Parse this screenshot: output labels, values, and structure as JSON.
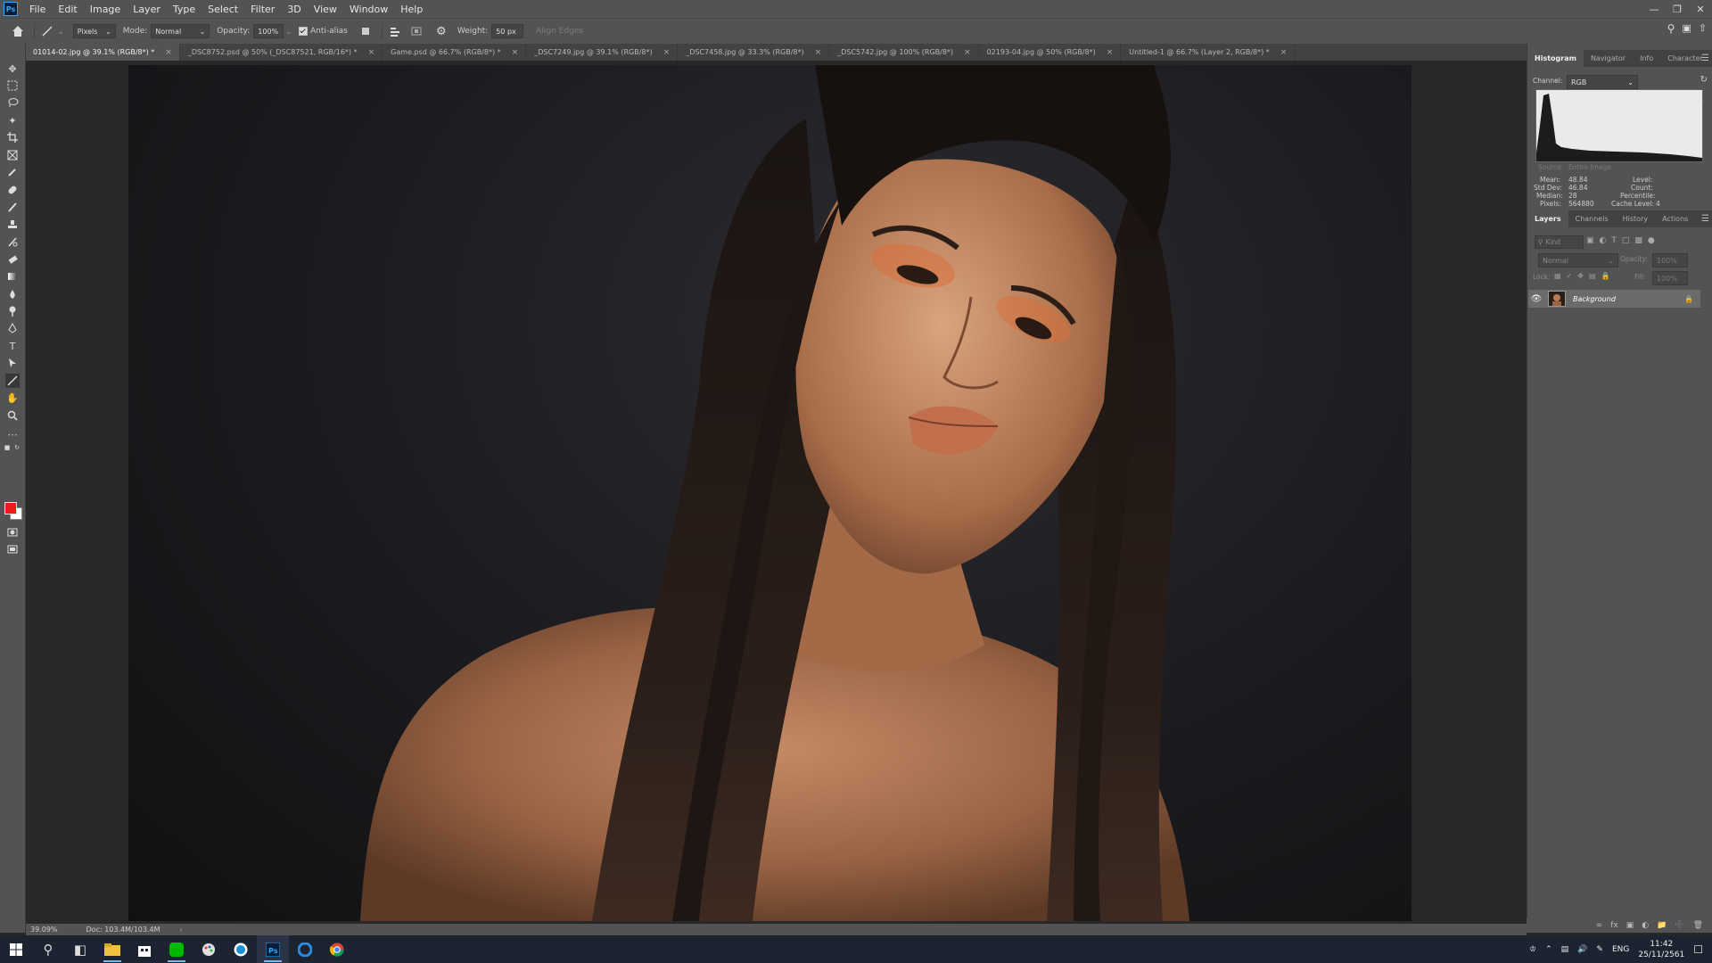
{
  "menu": {
    "logo": "Ps",
    "items": [
      "File",
      "Edit",
      "Image",
      "Layer",
      "Type",
      "Select",
      "Filter",
      "3D",
      "View",
      "Window",
      "Help"
    ]
  },
  "options": {
    "tool_mode_value": "Pixels",
    "mode_label": "Mode:",
    "mode_value": "Normal",
    "opacity_label": "Opacity:",
    "opacity_value": "100%",
    "antialias_label": "Anti-alias",
    "weight_label": "Weight:",
    "weight_value": "50 px",
    "align_edges_label": "Align Edges"
  },
  "tabs": [
    {
      "label": "01014-02.jpg @ 39.1% (RGB/8*) *",
      "active": true
    },
    {
      "label": "_DSC8752.psd @ 50% (_DSC87521, RGB/16*) *",
      "active": false
    },
    {
      "label": "Game.psd @ 66.7% (RGB/8*) *",
      "active": false
    },
    {
      "label": "_DSC7249.jpg @ 39.1% (RGB/8*)",
      "active": false
    },
    {
      "label": "_DSC7458.jpg @ 33.3% (RGB/8*)",
      "active": false
    },
    {
      "label": "_DSC5742.jpg @ 100% (RGB/8*)",
      "active": false
    },
    {
      "label": "02193-04.jpg @ 50% (RGB/8*)",
      "active": false
    },
    {
      "label": "Untitled-1 @ 66.7% (Layer 2, RGB/8*) *",
      "active": false
    }
  ],
  "status": {
    "zoom": "39.09%",
    "doc": "Doc: 103.4M/103.4M"
  },
  "histogram": {
    "tabs": [
      "Histogram",
      "Navigator",
      "Info",
      "Character"
    ],
    "channel_label": "Channel:",
    "channel_value": "RGB",
    "source_label": "Source:",
    "source_value": "Entire Image",
    "stats_left": [
      {
        "label": "Mean:",
        "value": "48.84"
      },
      {
        "label": "Std Dev:",
        "value": "46.84"
      },
      {
        "label": "Median:",
        "value": "28"
      },
      {
        "label": "Pixels:",
        "value": "564880"
      }
    ],
    "stats_right": [
      {
        "label": "Level:",
        "value": ""
      },
      {
        "label": "Count:",
        "value": ""
      },
      {
        "label": "Percentile:",
        "value": ""
      },
      {
        "label": "Cache Level:",
        "value": "4"
      }
    ]
  },
  "layers": {
    "tabs": [
      "Layers",
      "Channels",
      "History",
      "Actions"
    ],
    "filter_placeholder": "Kind",
    "blend_mode": "Normal",
    "opacity_label": "Opacity:",
    "opacity_value": "100%",
    "lock_label": "Lock:",
    "fill_label": "Fill:",
    "fill_value": "100%",
    "items": [
      {
        "name": "Background"
      }
    ]
  },
  "taskbar": {
    "lang": "ENG",
    "time": "11:42",
    "date": "25/11/2561"
  },
  "colors": {
    "foreground": "#ed1c1c",
    "background": "#ffffff",
    "accent": "#31a8ff"
  }
}
